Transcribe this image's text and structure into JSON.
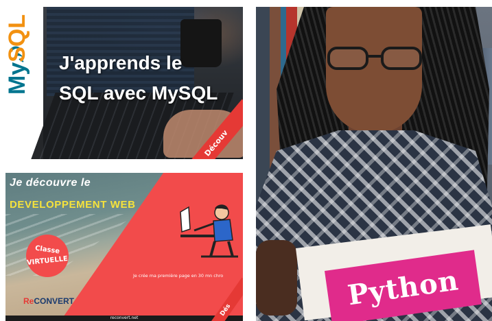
{
  "cards": {
    "mysql": {
      "logo_my": "My",
      "logo_sql": "SQL",
      "title_line1": "J'apprends le",
      "title_line2": "SQL avec MySQL",
      "ribbon": "Découv"
    },
    "web": {
      "title_line1": "Je découvre le",
      "title_line2": "DEVELOPPEMENT WEB",
      "circle_line1": "Classe",
      "circle_line2": "VIRTUELLE",
      "caption": "Je crée ma première page en 30 mn chro",
      "logo_re": "Re",
      "logo_convert": "CONVERT",
      "footer": "reconvert.net",
      "ribbon": "Dés"
    },
    "python": {
      "cover_title": "Python"
    }
  },
  "colors": {
    "mysql_blue": "#00758f",
    "mysql_orange": "#f29111",
    "web_red": "#f24b4b",
    "web_yellow": "#f6e33c",
    "python_pink": "#e02b8b"
  }
}
